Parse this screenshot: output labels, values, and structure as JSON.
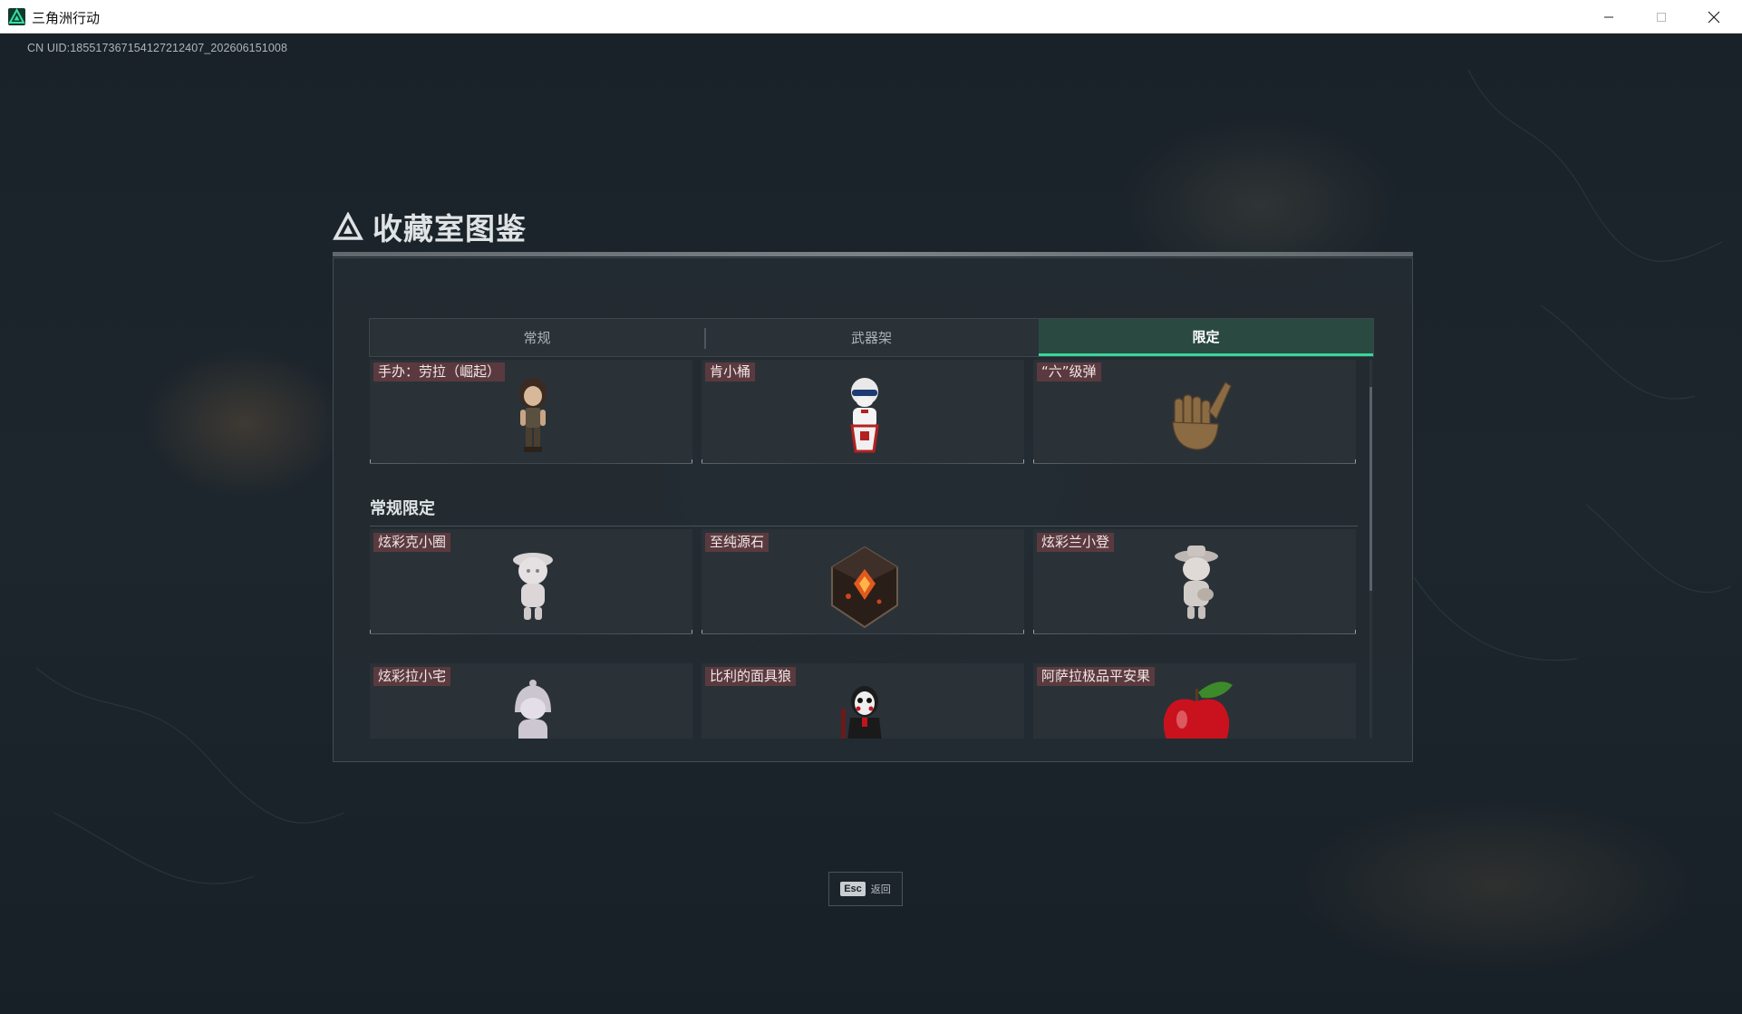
{
  "window": {
    "title": "三角洲行动",
    "controls": [
      "minimize",
      "maximize",
      "close"
    ]
  },
  "uid_text": "CN UID:185517367154127212407_202606151008",
  "panel": {
    "title": "收藏室图鉴",
    "tabs": [
      {
        "label": "常规",
        "active": false
      },
      {
        "label": "武器架",
        "active": false
      },
      {
        "label": "限定",
        "active": true
      }
    ],
    "first_row": [
      {
        "name": "手办：劳拉（崛起）",
        "icon": "lara-figure-icon"
      },
      {
        "name": "肯小桶",
        "icon": "colonel-figure-icon"
      },
      {
        "name": "“六”级弹",
        "icon": "bronze-hand-icon"
      }
    ],
    "section": {
      "title": "常规限定",
      "rows": [
        [
          {
            "name": "炫彩克小圈",
            "icon": "white-figure-icon"
          },
          {
            "name": "至纯源石",
            "icon": "gem-icon"
          },
          {
            "name": "炫彩兰小登",
            "icon": "figure-with-hat-icon"
          }
        ],
        [
          {
            "name": "炫彩拉小宅",
            "icon": "hooded-figure-icon"
          },
          {
            "name": "比利的面具狼",
            "icon": "puppet-icon"
          },
          {
            "name": "阿萨拉极品平安果",
            "icon": "apple-icon"
          }
        ]
      ]
    }
  },
  "esc_hint": {
    "key": "Esc",
    "label": "返回"
  },
  "colors": {
    "accent": "#39d69a",
    "active_tab": "#2a4a41",
    "name_tag": "#5a3a3f"
  }
}
